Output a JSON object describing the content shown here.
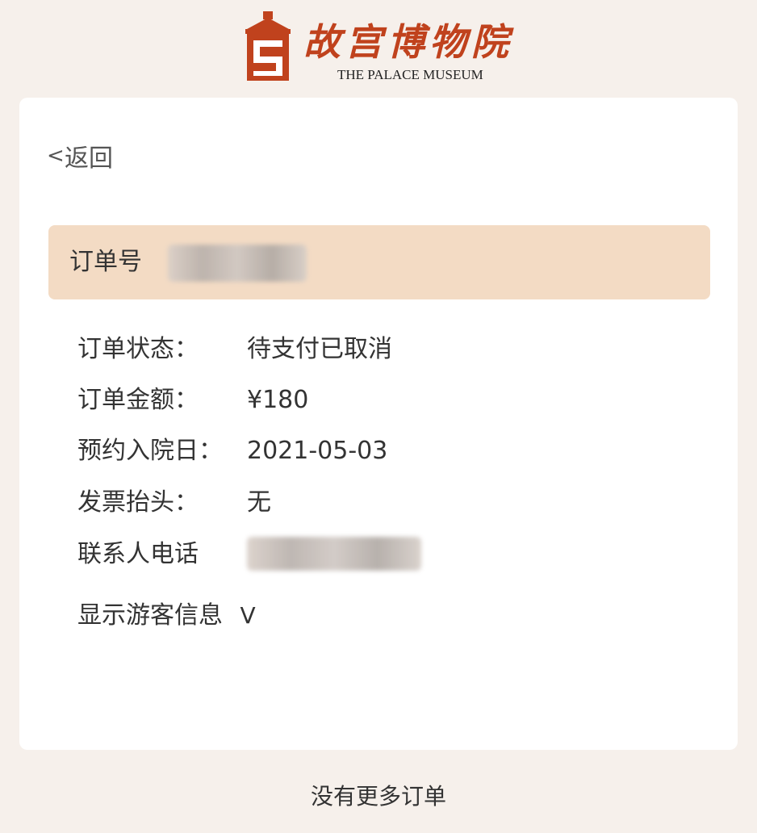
{
  "header": {
    "logo_icon": "palace-gate-icon",
    "logo_cn": "故宫博物院",
    "logo_en": "THE PALACE MUSEUM",
    "brand_color": "#c0421d"
  },
  "nav": {
    "back_icon": "chevron-left-icon",
    "back_symbol": "<",
    "back_label": "返回"
  },
  "order": {
    "number_label": "订单号",
    "highlight_color": "#f3dbc4"
  },
  "details": [
    {
      "label": "订单状态：",
      "value": "待支付已取消"
    },
    {
      "label": "订单金额：",
      "value": "¥180"
    },
    {
      "label": "预约入院日：",
      "value": "2021-05-03"
    },
    {
      "label": "发票抬头：",
      "value": "无"
    },
    {
      "label": "联系人电话"
    }
  ],
  "guests": {
    "toggle_label": "显示游客信息",
    "toggle_icon": "chevron-down-icon",
    "toggle_symbol": "V"
  },
  "footer": {
    "no_more": "没有更多订单"
  }
}
